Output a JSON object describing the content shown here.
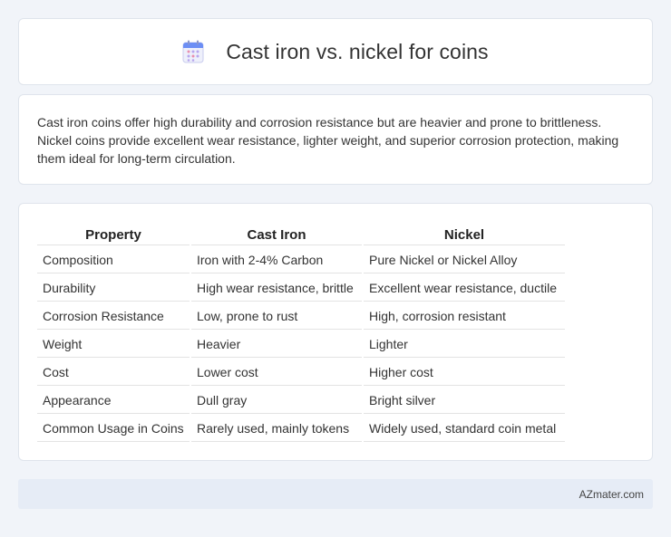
{
  "header": {
    "title": "Cast iron vs. nickel for coins",
    "icon": "calendar-icon"
  },
  "summary": {
    "text": "Cast iron coins offer high durability and corrosion resistance but are heavier and prone to brittleness. Nickel coins provide excellent wear resistance, lighter weight, and superior corrosion protection, making them ideal for long-term circulation."
  },
  "table": {
    "headers": [
      "Property",
      "Cast Iron",
      "Nickel"
    ],
    "rows": [
      [
        "Composition",
        "Iron with 2-4% Carbon",
        "Pure Nickel or Nickel Alloy"
      ],
      [
        "Durability",
        "High wear resistance, brittle",
        "Excellent wear resistance, ductile"
      ],
      [
        "Corrosion Resistance",
        "Low, prone to rust",
        "High, corrosion resistant"
      ],
      [
        "Weight",
        "Heavier",
        "Lighter"
      ],
      [
        "Cost",
        "Lower cost",
        "Higher cost"
      ],
      [
        "Appearance",
        "Dull gray",
        "Bright silver"
      ],
      [
        "Common Usage in Coins",
        "Rarely used, mainly tokens",
        "Widely used, standard coin metal"
      ]
    ]
  },
  "footer": {
    "text": "AZmater.com"
  }
}
